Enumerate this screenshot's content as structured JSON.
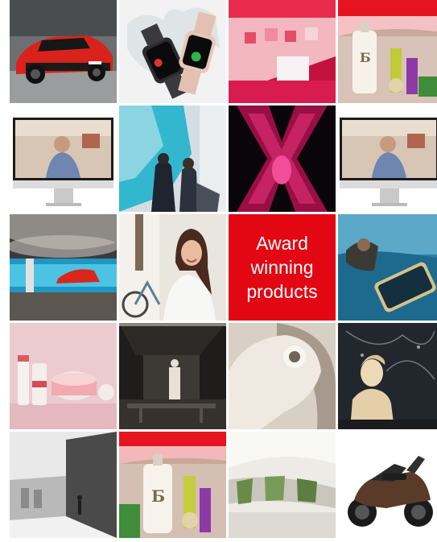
{
  "tiles": [
    {
      "row": 1,
      "col": 1,
      "name": "tile-red-electric-car",
      "kind": "photo"
    },
    {
      "row": 1,
      "col": 2,
      "name": "tile-smartwatches-splash",
      "kind": "photo"
    },
    {
      "row": 1,
      "col": 3,
      "name": "tile-red-pink-interior",
      "kind": "photo"
    },
    {
      "row": 1,
      "col": 4,
      "name": "tile-bottle-drinks-b",
      "kind": "photo",
      "text": "Б"
    },
    {
      "row": 2,
      "col": 1,
      "name": "tile-monitor-man",
      "kind": "photo"
    },
    {
      "row": 2,
      "col": 2,
      "name": "tile-blue-wall-people",
      "kind": "photo"
    },
    {
      "row": 2,
      "col": 3,
      "name": "tile-magenta-x",
      "kind": "photo"
    },
    {
      "row": 2,
      "col": 4,
      "name": "tile-monitor-man-2",
      "kind": "photo"
    },
    {
      "row": 3,
      "col": 1,
      "name": "tile-blue-car-showroom",
      "kind": "photo"
    },
    {
      "row": 3,
      "col": 2,
      "name": "tile-woman-bicycle",
      "kind": "photo"
    },
    {
      "row": 3,
      "col": 3,
      "name": "tile-award-winning-products",
      "kind": "cta",
      "lines": [
        "Award",
        "winning",
        "products"
      ]
    },
    {
      "row": 3,
      "col": 4,
      "name": "tile-blue-water-device",
      "kind": "photo"
    },
    {
      "row": 4,
      "col": 1,
      "name": "tile-pink-cosmetics",
      "kind": "photo"
    },
    {
      "row": 4,
      "col": 2,
      "name": "tile-dark-room-interior",
      "kind": "photo"
    },
    {
      "row": 4,
      "col": 3,
      "name": "tile-spiral-staircase",
      "kind": "photo"
    },
    {
      "row": 4,
      "col": 4,
      "name": "tile-statue-map",
      "kind": "photo"
    },
    {
      "row": 5,
      "col": 1,
      "name": "tile-bw-architecture",
      "kind": "photo"
    },
    {
      "row": 5,
      "col": 2,
      "name": "tile-bottle-drinks-b-2",
      "kind": "photo",
      "text": "Б"
    },
    {
      "row": 5,
      "col": 3,
      "name": "tile-white-curved-interior",
      "kind": "photo"
    },
    {
      "row": 5,
      "col": 4,
      "name": "tile-motorcycle",
      "kind": "photo"
    }
  ],
  "colors": {
    "accent": "#e30613",
    "cta_text": "#ffffff"
  }
}
